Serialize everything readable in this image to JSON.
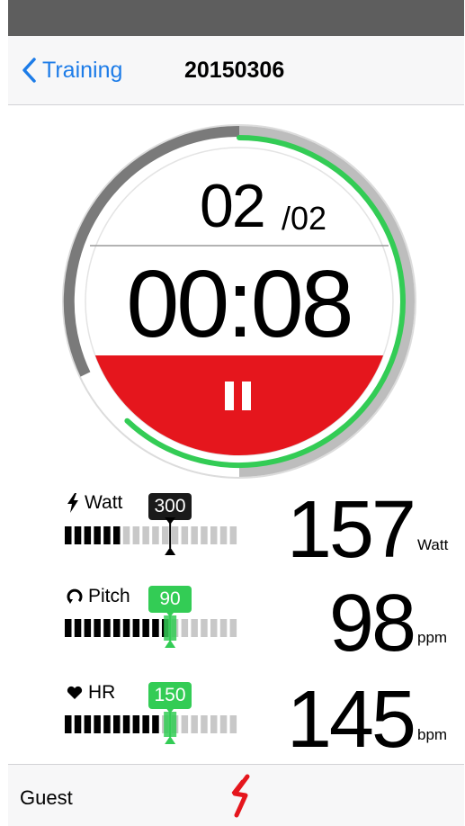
{
  "nav": {
    "back_label": "Training",
    "title": "20150306"
  },
  "timer": {
    "set_current": "02",
    "set_total": "/02",
    "time": "00:08",
    "progress": 0.62,
    "pause_label": "pause"
  },
  "metrics": [
    {
      "label": "Watt",
      "icon": "lightning-icon",
      "target": "300",
      "value": "157",
      "unit": "Watt",
      "filled_segments": 6,
      "target_segment": 11,
      "marker_color": "#000000",
      "segments": 18
    },
    {
      "label": "Pitch",
      "icon": "cadence-icon",
      "target": "90",
      "value": "98",
      "unit": "ppm",
      "filled_segments": 11,
      "target_segment": 11,
      "marker_color": "#33cc55",
      "segments": 18
    },
    {
      "label": "HR",
      "icon": "heart-icon",
      "target": "150",
      "value": "145",
      "unit": "bpm",
      "filled_segments": 10,
      "target_segment": 11,
      "marker_color": "#33cc55",
      "segments": 18
    }
  ],
  "footer": {
    "user": "Guest",
    "logo": "brand-logo-icon"
  },
  "colors": {
    "accent_blue": "#1d7ce8",
    "green": "#33cc55",
    "red": "#e5161d",
    "dark_gray": "#7a7a7a",
    "light_gray": "#bdbdbd"
  }
}
